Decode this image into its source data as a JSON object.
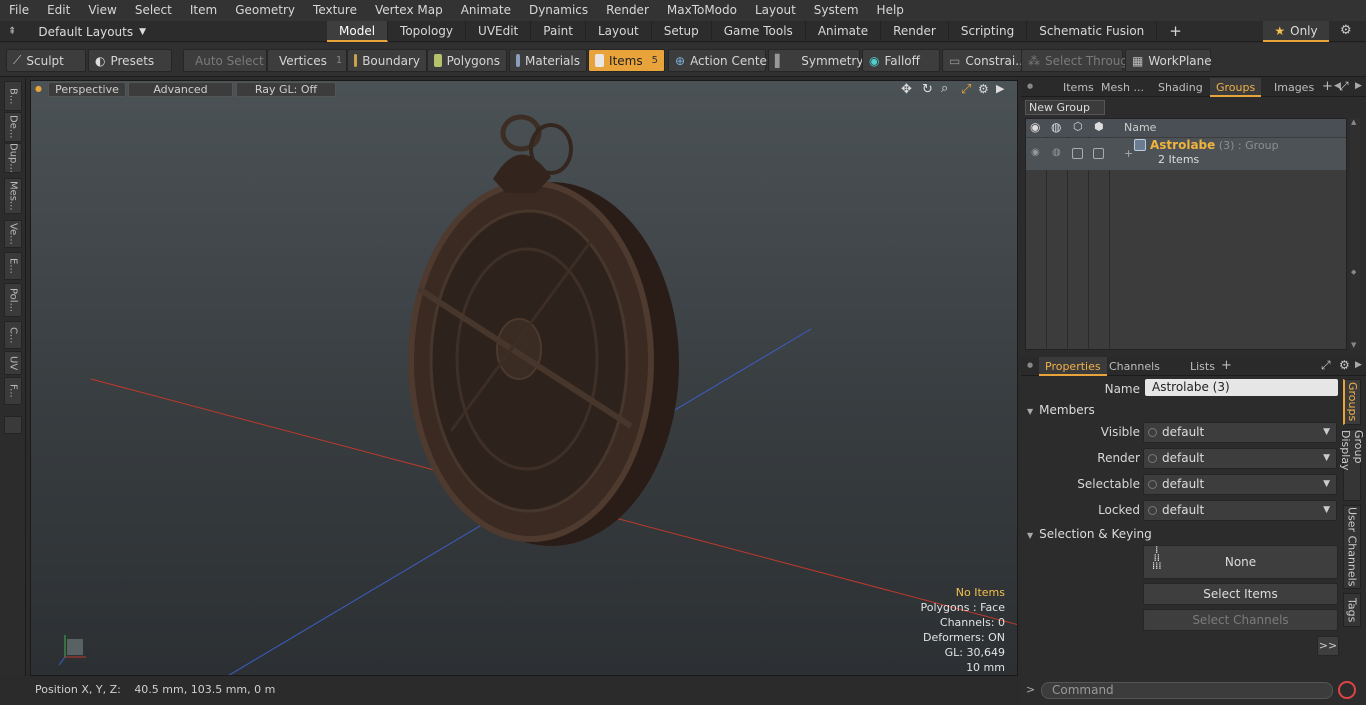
{
  "menu": [
    "File",
    "Edit",
    "View",
    "Select",
    "Item",
    "Geometry",
    "Texture",
    "Vertex Map",
    "Animate",
    "Dynamics",
    "Render",
    "MaxToModo",
    "Layout",
    "System",
    "Help"
  ],
  "layouts": {
    "label": "Default Layouts"
  },
  "tabs": [
    "Model",
    "Topology",
    "UVEdit",
    "Paint",
    "Layout",
    "Setup",
    "Game Tools",
    "Animate",
    "Render",
    "Scripting",
    "Schematic Fusion"
  ],
  "only_label": "Only",
  "toolbar": {
    "sculpt": "Sculpt",
    "presets": "Presets",
    "auto_select": "Auto Select",
    "vertices": "Vertices",
    "vertices_count": "1",
    "boundary": "Boundary",
    "polygons": "Polygons",
    "materials": "Materials",
    "items": "Items",
    "items_count": "5",
    "action_center": "Action Center",
    "symmetry": "Symmetry",
    "falloff": "Falloff",
    "constraints": "Constrai...",
    "select_through": "Select Through",
    "workplane": "WorkPlane"
  },
  "left_tabs": [
    "B...",
    "De...",
    "Dup...",
    "Mes...",
    "Ve...",
    "E...",
    "Pol...",
    "C...",
    "UV",
    "F..."
  ],
  "viewport": {
    "perspective": "Perspective",
    "advanced": "Advanced",
    "raygl": "Ray GL: Off"
  },
  "hud": {
    "no_items": "No Items",
    "polygons": "Polygons : Face",
    "channels": "Channels: 0",
    "deformers": "Deformers: ON",
    "gl": "GL: 30,649",
    "scale": "10 mm"
  },
  "status": {
    "label": "Position X, Y, Z:",
    "value": "40.5 mm, 103.5 mm, 0 m"
  },
  "top_panel": {
    "tabs": [
      "Items",
      "Mesh ...",
      "Shading",
      "Groups",
      "Images"
    ],
    "new_group": "New Group",
    "col_name": "Name",
    "group": {
      "name": "Astrolabe",
      "count": "(3)",
      "type": ": Group",
      "items": "2 Items"
    }
  },
  "props_panel": {
    "tabs": [
      "Properties",
      "Channels",
      "Lists"
    ],
    "name_label": "Name",
    "name_value": "Astrolabe (3)",
    "members": "Members",
    "fields": [
      {
        "label": "Visible",
        "value": "default"
      },
      {
        "label": "Render",
        "value": "default"
      },
      {
        "label": "Selectable",
        "value": "default"
      },
      {
        "label": "Locked",
        "value": "default"
      }
    ],
    "selection_keying": "Selection & Keying",
    "none": "None",
    "select_items": "Select Items",
    "select_channels": "Select Channels",
    "more": ">>",
    "side_tabs": [
      "Groups",
      "Group Display",
      "User Channels",
      "Tags"
    ]
  },
  "command": {
    "placeholder": "Command"
  }
}
